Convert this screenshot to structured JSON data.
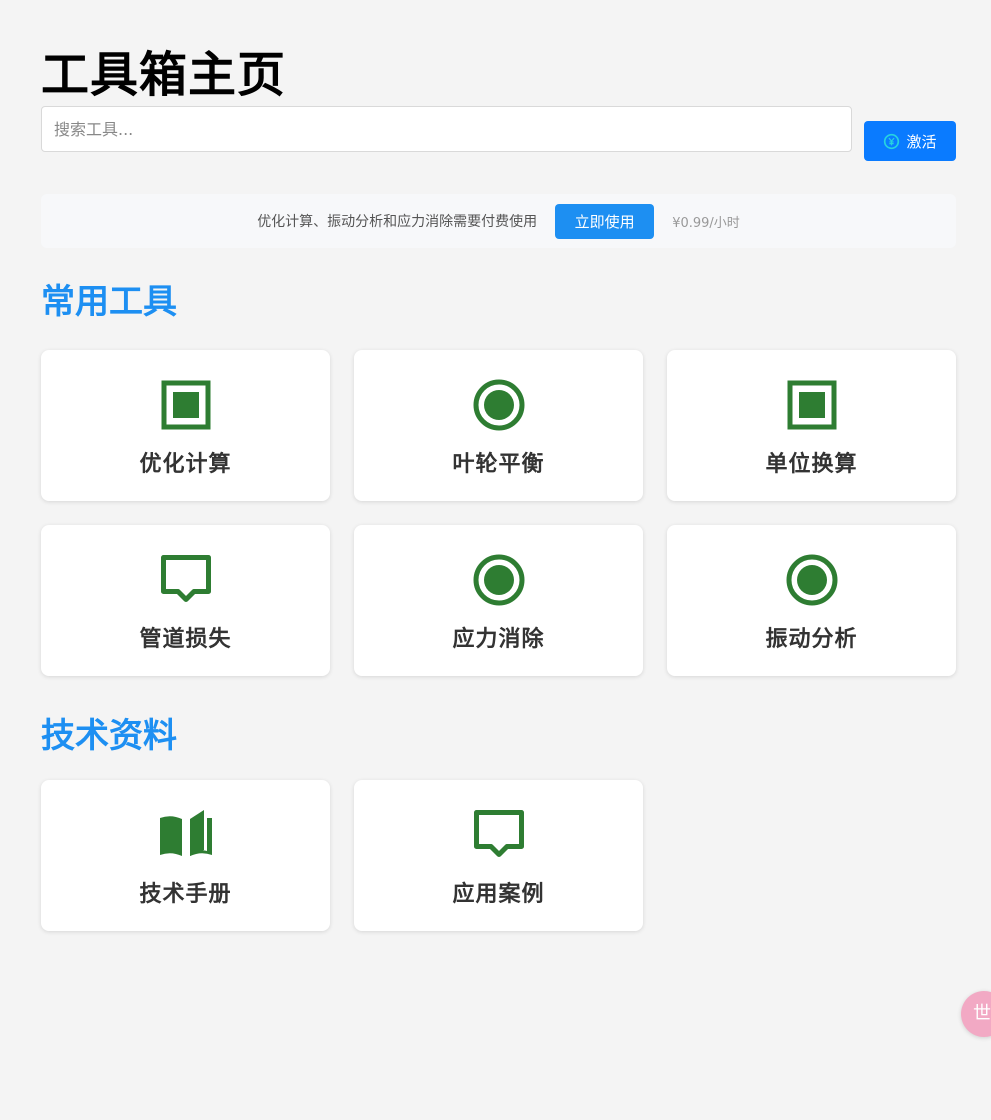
{
  "header": {
    "title": "工具箱主页"
  },
  "search": {
    "placeholder": "搜索工具..."
  },
  "activate_button": {
    "icon": "coin-icon",
    "label": "激活",
    "color": "#0a7bff"
  },
  "banner": {
    "text": "优化计算、振动分析和应力消除需要付费使用",
    "button_label": "立即使用",
    "price": "¥0.99/小时"
  },
  "sections": [
    {
      "title": "常用工具",
      "tools": [
        {
          "label": "优化计算",
          "icon": "square-icon"
        },
        {
          "label": "叶轮平衡",
          "icon": "circle-icon"
        },
        {
          "label": "单位换算",
          "icon": "square-icon"
        },
        {
          "label": "管道损失",
          "icon": "chat-bubble-icon"
        },
        {
          "label": "应力消除",
          "icon": "circle-icon"
        },
        {
          "label": "振动分析",
          "icon": "circle-icon"
        }
      ]
    },
    {
      "title": "技术资料",
      "tools": [
        {
          "label": "技术手册",
          "icon": "book-icon"
        },
        {
          "label": "应用案例",
          "icon": "chat-bubble-icon"
        }
      ]
    }
  ],
  "floating_button": {
    "text": "世"
  },
  "colors": {
    "accent": "#1d8ff2",
    "icon_green": "#2e7d32",
    "background": "#f4f4f4"
  }
}
